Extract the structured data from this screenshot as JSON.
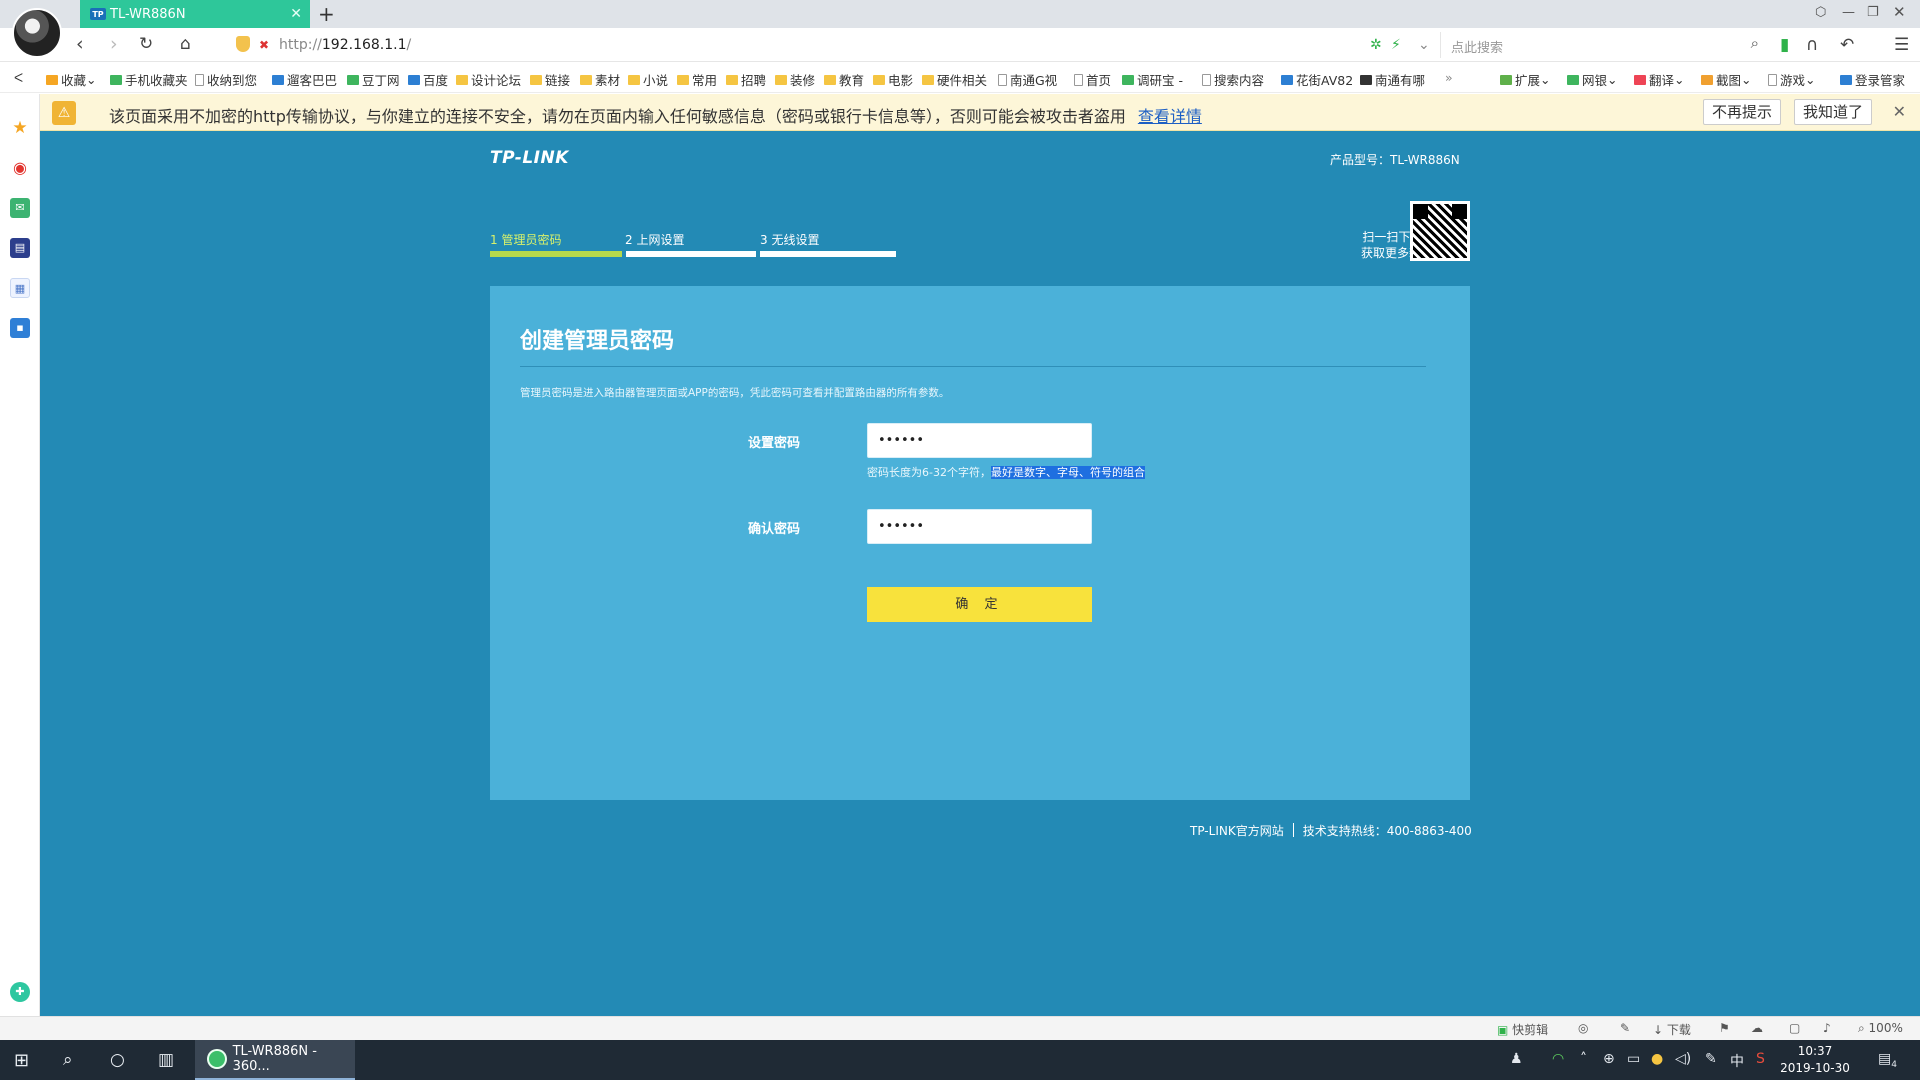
{
  "browser": {
    "tab_title": "TL-WR886N",
    "tab_favicon_text": "TP",
    "url_prefix": "http://",
    "url_host": "192.168.1.1",
    "url_suffix": "/",
    "search_placeholder": "点此搜索"
  },
  "bookmarks": [
    {
      "label": "收藏",
      "icon": "star-icon"
    },
    {
      "label": "手机收藏夹",
      "icon": "phone-icon"
    },
    {
      "label": "收纳到您",
      "icon": "page-icon"
    },
    {
      "label": "遛客巴巴",
      "icon": "page-icon"
    },
    {
      "label": "豆丁网",
      "icon": "green-icon"
    },
    {
      "label": "百度",
      "icon": "baidu-icon"
    },
    {
      "label": "设计论坛",
      "icon": "folder-icon"
    },
    {
      "label": "链接",
      "icon": "folder-icon"
    },
    {
      "label": "素材",
      "icon": "folder-icon"
    },
    {
      "label": "小说",
      "icon": "folder-icon"
    },
    {
      "label": "常用",
      "icon": "folder-icon"
    },
    {
      "label": "招聘",
      "icon": "folder-icon"
    },
    {
      "label": "装修",
      "icon": "folder-icon"
    },
    {
      "label": "教育",
      "icon": "folder-icon"
    },
    {
      "label": "电影",
      "icon": "folder-icon"
    },
    {
      "label": "硬件相关",
      "icon": "folder-icon"
    },
    {
      "label": "南通G视",
      "icon": "page-icon"
    },
    {
      "label": "首页",
      "icon": "page-icon"
    },
    {
      "label": "调研宝 -",
      "icon": "green-icon"
    },
    {
      "label": "搜索内容",
      "icon": "page-icon"
    },
    {
      "label": "花街AV82",
      "icon": "blue-icon"
    },
    {
      "label": "南通有哪",
      "icon": "page-icon"
    },
    {
      "label": "»",
      "icon": ""
    }
  ],
  "bookmark_tools": [
    {
      "label": "扩展"
    },
    {
      "label": "网银"
    },
    {
      "label": "翻译"
    },
    {
      "label": "截图"
    },
    {
      "label": "游戏"
    },
    {
      "label": "登录管家"
    }
  ],
  "warning": {
    "text": "该页面采用不加密的http传输协议，与你建立的连接不安全，请勿在页面内输入任何敏感信息（密码或银行卡信息等），否则可能会被攻击者盗用",
    "link": "查看详情",
    "btn_dismiss_forever": "不再提示",
    "btn_ok": "我知道了"
  },
  "router": {
    "logo": "TP-LINK",
    "model_label": "产品型号：TL-WR886N",
    "steps": [
      {
        "label": "1 管理员密码",
        "active": true
      },
      {
        "label": "2 上网设置",
        "active": false
      },
      {
        "label": "3 无线设置",
        "active": false
      }
    ],
    "qr_line1": "扫一扫下载APP",
    "qr_line2": "获取更多新功能",
    "title": "创建管理员密码",
    "description": "管理员密码是进入路由器管理页面或APP的密码，凭此密码可查看并配置路由器的所有参数。",
    "password_label": "设置密码",
    "password_value": "••••••",
    "hint_plain": "密码长度为6-32个字符，",
    "hint_selected": "最好是数字、字母、符号的组合",
    "confirm_label": "确认密码",
    "confirm_value": "••••••",
    "submit": "确 定",
    "footer_site": "TP-LINK官方网站",
    "footer_hotline": "技术支持热线：400-8863-400"
  },
  "statusbar": {
    "quick_cut": "快剪辑",
    "download": "下载",
    "zoom": "100%"
  },
  "taskbar": {
    "app_label": "TL-WR886N - 360...",
    "ime": "中",
    "time": "10:37",
    "date": "2019-10-30",
    "notification_count": "4"
  },
  "colors": {
    "page_bg": "#238ab5",
    "card_bg": "#4bb1d9",
    "step_active": "#b6d94c",
    "submit_bg": "#f8e23c",
    "tab_bg": "#2ec79a"
  }
}
